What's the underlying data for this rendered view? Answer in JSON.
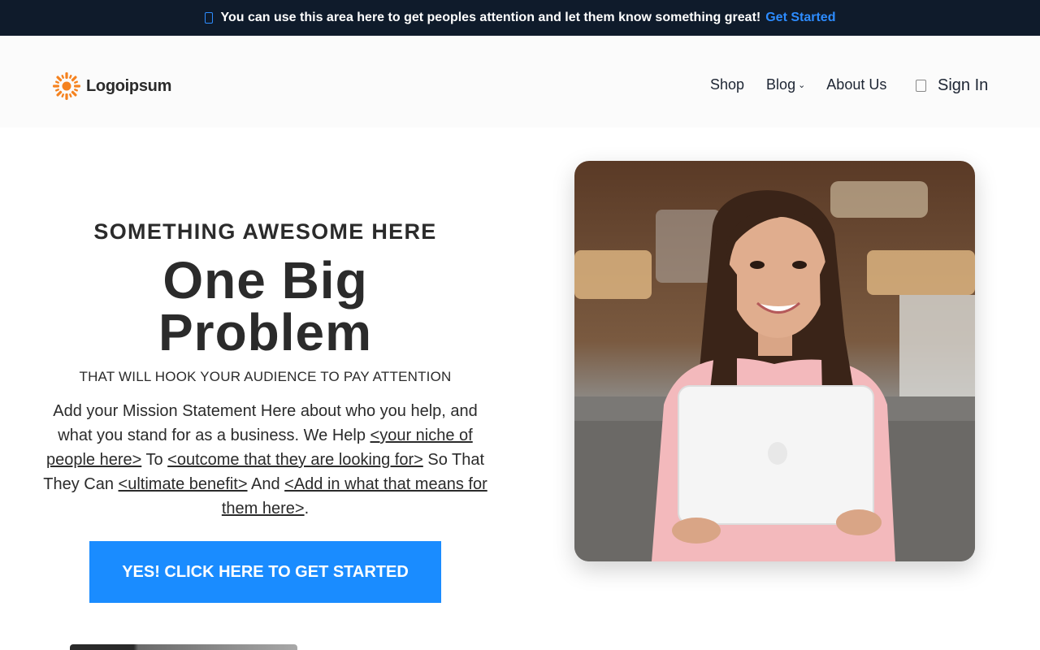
{
  "topbar": {
    "message": "You can use this area here to get peoples attention and let them know something great!",
    "cta_label": "Get Started",
    "icon": "bell-icon"
  },
  "header": {
    "logo_text": "Logoipsum",
    "nav": [
      {
        "label": "Shop"
      },
      {
        "label": "Blog",
        "has_dropdown": true
      },
      {
        "label": "About Us"
      }
    ],
    "signin_label": "Sign In"
  },
  "hero": {
    "eyebrow": "SOMETHING AWESOME HERE",
    "headline_line1": "One Big",
    "headline_line2": "Problem",
    "subhead": "THAT WILL HOOK YOUR AUDIENCE TO PAY ATTENTION",
    "mission": {
      "part1": "Add your Mission Statement Here about who you help, and what you stand for as a business. We Help ",
      "link1": "<your niche of people here>",
      "part2": " To ",
      "link2": "<outcome that they are looking for>",
      "part3": " So That They Can ",
      "link3": "<ultimate benefit>",
      "part4": " And ",
      "link4": "<Add in what that means for them here>",
      "part5": "."
    },
    "cta_label": "YES! CLICK HERE TO GET STARTED"
  },
  "colors": {
    "topbar_bg": "#0f1b2b",
    "accent": "#1a8cff",
    "logo_orange": "#f5821f"
  }
}
